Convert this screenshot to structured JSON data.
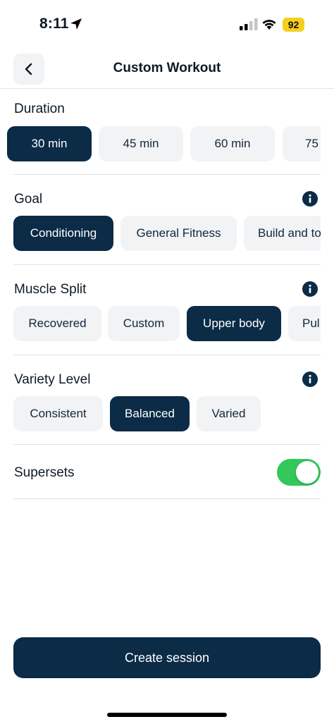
{
  "status_bar": {
    "time": "8:11",
    "battery": "92"
  },
  "header": {
    "title": "Custom Workout"
  },
  "sections": {
    "duration": {
      "title": "Duration",
      "options": [
        "30 min",
        "45 min",
        "60 min",
        "75"
      ],
      "selected": "30 min"
    },
    "goal": {
      "title": "Goal",
      "options": [
        "Conditioning",
        "General Fitness",
        "Build and to"
      ],
      "selected": "Conditioning"
    },
    "muscle_split": {
      "title": "Muscle Split",
      "options": [
        "Recovered",
        "Custom",
        "Upper body",
        "Pul"
      ],
      "selected": "Upper body"
    },
    "variety": {
      "title": "Variety Level",
      "options": [
        "Consistent",
        "Balanced",
        "Varied"
      ],
      "selected": "Balanced"
    },
    "supersets": {
      "title": "Supersets",
      "enabled": true
    }
  },
  "actions": {
    "create_label": "Create session"
  },
  "colors": {
    "primary": "#0b2b46",
    "chip_bg": "#f1f3f5",
    "toggle_on": "#34c759",
    "battery": "#f5cf1f"
  },
  "icons": [
    "location-arrow-icon",
    "signal-icon",
    "wifi-icon",
    "back-chevron-icon",
    "info-icon"
  ]
}
